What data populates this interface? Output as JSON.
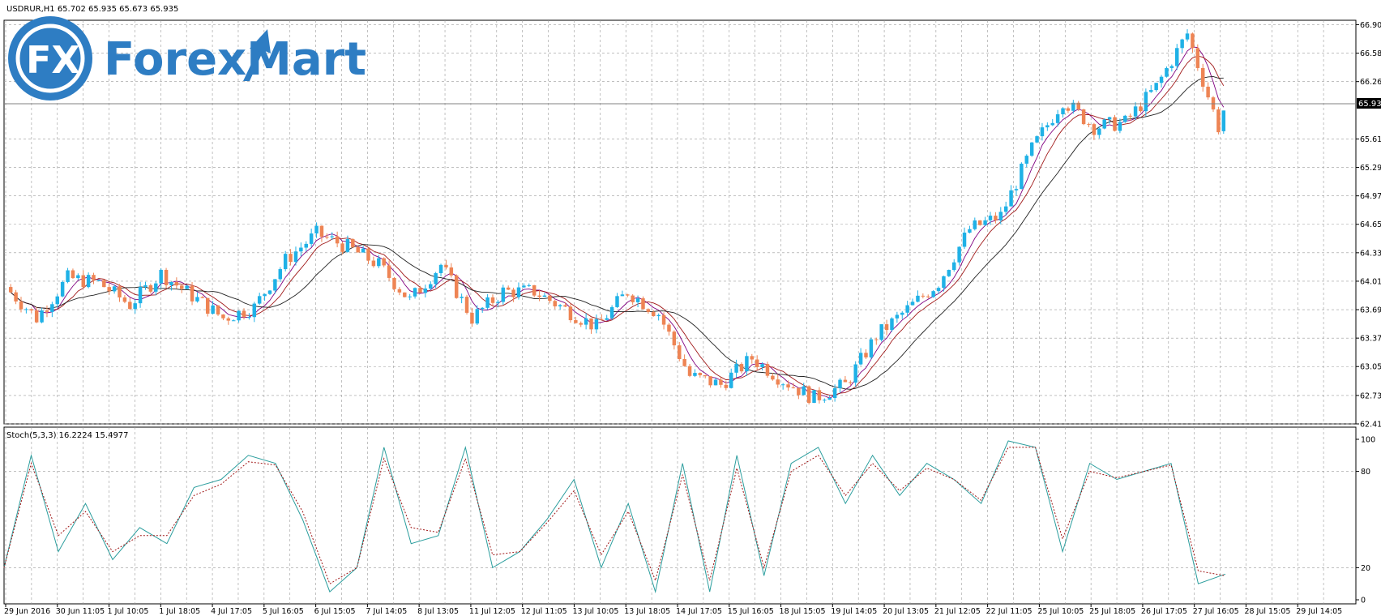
{
  "window": {
    "symbol_line": "USDRUR,H1  65.702 65.935 65.673 65.935"
  },
  "logo": {
    "mark_text": "FX",
    "brand_name": "ForexMart"
  },
  "price_axis": {
    "ticks": [
      "66.900",
      "66.580",
      "66.260",
      "65.615",
      "65.295",
      "64.975",
      "64.655",
      "64.335",
      "64.015",
      "63.695",
      "63.375",
      "63.055",
      "62.730",
      "62.410"
    ],
    "current_price_label": "65.935"
  },
  "stoch": {
    "label": "Stoch(5,3,3) 16.2224 15.4977",
    "ticks": [
      "100",
      "80",
      "20",
      "0"
    ]
  },
  "time_axis": {
    "labels": [
      "29 Jun 2016",
      "30 Jun 11:05",
      "1 Jul 10:05",
      "1 Jul 18:05",
      "4 Jul 17:05",
      "5 Jul 16:05",
      "6 Jul 15:05",
      "7 Jul 14:05",
      "8 Jul 13:05",
      "11 Jul 12:05",
      "12 Jul 11:05",
      "13 Jul 10:05",
      "13 Jul 18:05",
      "14 Jul 17:05",
      "15 Jul 16:05",
      "18 Jul 15:05",
      "19 Jul 14:05",
      "20 Jul 13:05",
      "21 Jul 12:05",
      "22 Jul 11:05",
      "25 Jul 10:05",
      "25 Jul 18:05",
      "26 Jul 17:05",
      "27 Jul 16:05",
      "28 Jul 15:05",
      "29 Jul 14:05"
    ]
  },
  "colors": {
    "bull": "#1fb1e6",
    "bear": "#ee8454",
    "ma_fast": "#800080",
    "ma_mid": "#a01818",
    "ma_slow": "#222222",
    "stoch_main": "#2a9d9d",
    "stoch_signal": "#a01818",
    "grid": "#9a9a9a",
    "logo_blue": "#2e7dc3"
  },
  "chart_data": [
    {
      "type": "candlestick",
      "title": "USDRUR,H1",
      "ylim": [
        62.41,
        66.95
      ],
      "last_price": 65.935,
      "open_high_low_close_last": [
        65.702,
        65.935,
        65.673,
        65.935
      ],
      "series": [
        {
          "name": "USDRUR close (sampled)",
          "close": [
            63.95,
            63.6,
            64.05,
            64.0,
            63.75,
            64.1,
            63.85,
            63.6,
            63.72,
            64.25,
            64.55,
            64.4,
            64.2,
            63.8,
            64.2,
            63.6,
            63.9,
            63.9,
            63.7,
            63.5,
            63.9,
            63.65,
            62.95,
            62.85,
            63.15,
            62.9,
            62.7,
            62.85,
            63.4,
            63.7,
            64.0,
            64.6,
            64.75,
            65.5,
            66.05,
            65.75,
            65.8,
            66.2,
            66.8,
            65.75
          ]
        }
      ]
    },
    {
      "type": "line",
      "title": "Stoch(5,3,3)",
      "ylim": [
        0,
        100
      ],
      "levels": [
        80,
        20
      ],
      "series": [
        {
          "name": "main",
          "last": 16.2224,
          "values": [
            20,
            90,
            30,
            60,
            25,
            45,
            35,
            70,
            75,
            90,
            85,
            50,
            5,
            20,
            95,
            35,
            40,
            95,
            20,
            30,
            50,
            75,
            20,
            60,
            5,
            85,
            5,
            90,
            15,
            85,
            95,
            60,
            90,
            65,
            85,
            75,
            60,
            99,
            95,
            30,
            85,
            75,
            80,
            85,
            10,
            16
          ]
        },
        {
          "name": "signal",
          "last": 15.4977,
          "values": [
            20,
            85,
            40,
            55,
            30,
            40,
            40,
            65,
            72,
            86,
            84,
            55,
            10,
            20,
            88,
            45,
            42,
            88,
            28,
            30,
            48,
            68,
            28,
            55,
            12,
            78,
            12,
            82,
            20,
            80,
            90,
            65,
            85,
            68,
            82,
            75,
            62,
            95,
            95,
            38,
            80,
            76,
            80,
            84,
            18,
            15
          ]
        }
      ]
    }
  ]
}
